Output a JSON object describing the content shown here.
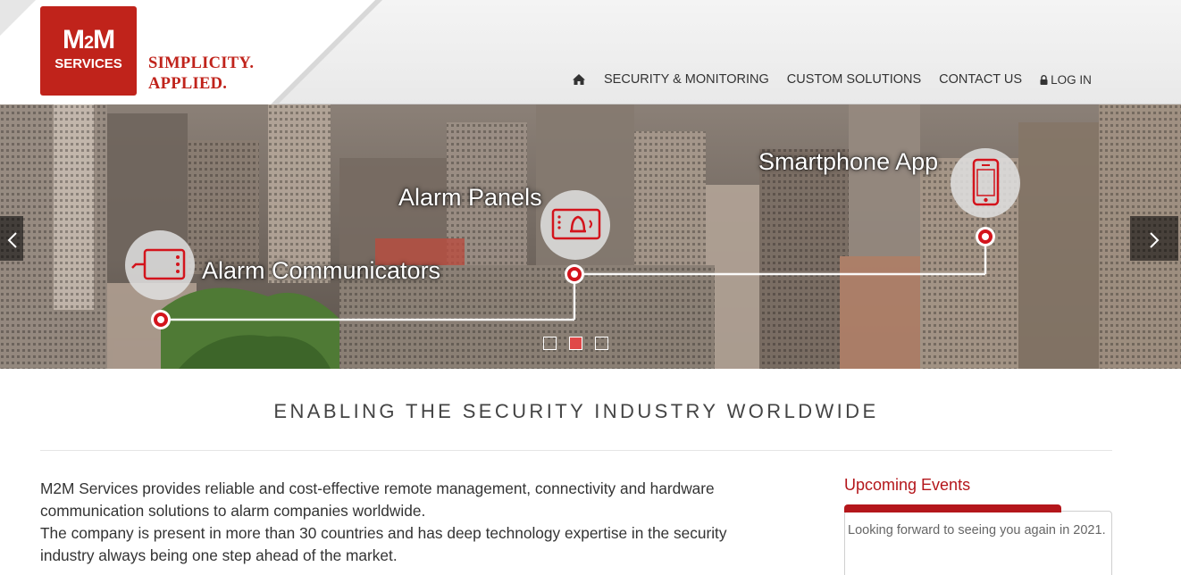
{
  "brand": {
    "logo_line1": "M2M",
    "logo_m": "M",
    "logo_2": "2",
    "logo_m_end": "M",
    "logo_line2": "SERVICES",
    "tagline_line1": "SIMPLICITY.",
    "tagline_line2": "APPLIED.",
    "color": "#c0231b"
  },
  "nav": {
    "home_icon": "home-icon",
    "items": [
      {
        "label": "SECURITY & MONITORING"
      },
      {
        "label": "CUSTOM SOLUTIONS"
      },
      {
        "label": "CONTACT US"
      }
    ],
    "login_icon": "lock-icon",
    "login_label": "LOG IN"
  },
  "slider": {
    "labels": {
      "communicators": "Alarm Communicators",
      "panels": "Alarm Panels",
      "app": "Smartphone App"
    },
    "icons": [
      "communicator-device-icon",
      "alarm-panel-icon",
      "smartphone-icon"
    ],
    "prev_icon": "chevron-left-icon",
    "next_icon": "chevron-right-icon",
    "slide_count": 3,
    "active_slide": 2,
    "accent": "#d3141c"
  },
  "main": {
    "headline": "ENABLING THE SECURITY INDUSTRY WORLDWIDE",
    "intro_line1": "M2M Services provides reliable and cost-effective remote management, connectivity and hardware communication solutions to alarm companies worldwide.",
    "intro_line2": "The company is present in more than 30 countries and has deep technology expertise in the security industry always being one step ahead of the market."
  },
  "events": {
    "title": "Upcoming Events",
    "text": "Looking forward to seeing you again in 2021.",
    "accent": "#b4161b"
  }
}
